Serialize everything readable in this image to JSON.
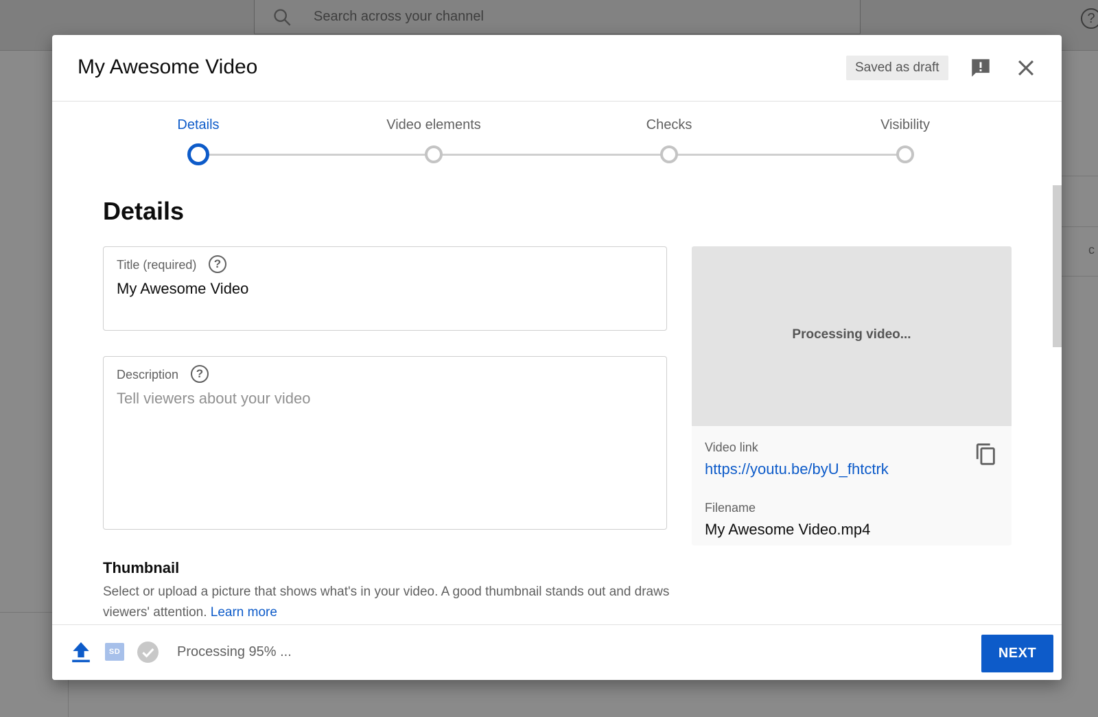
{
  "background": {
    "search_placeholder": "Search across your channel",
    "help_glyph": "?",
    "right_partial_letter": "c"
  },
  "dialog": {
    "title": "My Awesome Video",
    "draft_badge": "Saved as draft",
    "feedback_icon": "feedback-icon",
    "close_icon": "close-icon"
  },
  "stepper": {
    "steps": [
      {
        "label": "Details",
        "active": true
      },
      {
        "label": "Video elements",
        "active": false
      },
      {
        "label": "Checks",
        "active": false
      },
      {
        "label": "Visibility",
        "active": false
      }
    ],
    "accent_color": "#0d5bc9"
  },
  "details": {
    "heading": "Details",
    "title_field": {
      "label": "Title (required)",
      "value": "My Awesome Video",
      "help_glyph": "?"
    },
    "description_field": {
      "label": "Description",
      "placeholder": "Tell viewers about your video",
      "help_glyph": "?"
    },
    "preview": {
      "processing_text": "Processing video...",
      "video_link_label": "Video link",
      "video_link": "https://youtu.be/byU_fhtctrk",
      "filename_label": "Filename",
      "filename": "My Awesome Video.mp4"
    },
    "thumbnail": {
      "heading": "Thumbnail",
      "description": "Select or upload a picture that shows what's in your video. A good thumbnail stands out and draws viewers' attention.",
      "learn_more": "Learn more"
    }
  },
  "footer": {
    "sd_badge": "SD",
    "status_text": "Processing 95% ...",
    "processing_progress_percent": 95,
    "next_label": "NEXT"
  }
}
